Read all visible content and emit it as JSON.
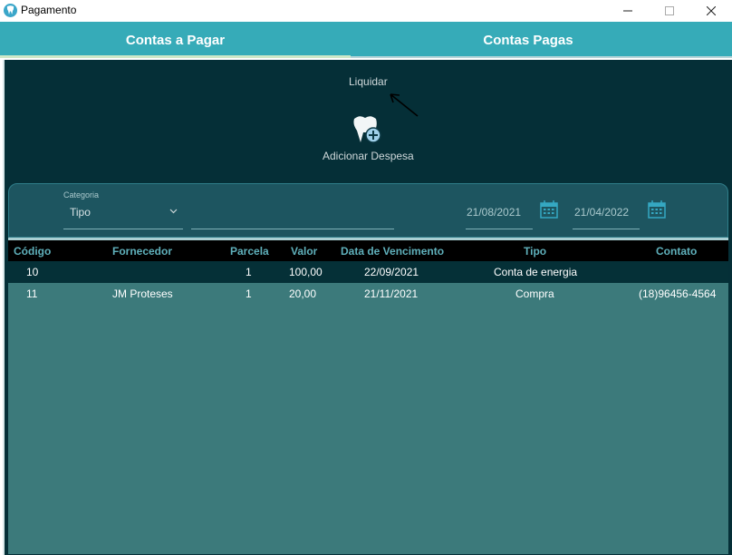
{
  "window": {
    "title": "Pagamento",
    "app_icon": "tooth-icon",
    "controls": [
      "minimize-icon",
      "maximize-icon",
      "close-icon"
    ]
  },
  "tabs": [
    {
      "label": "Contas a Pagar",
      "active": true
    },
    {
      "label": "Contas Pagas",
      "active": false
    }
  ],
  "actions": {
    "liquidar_label": "Liquidar",
    "add_expense_label": "Adicionar Despesa",
    "add_expense_icon": "tooth-add-icon"
  },
  "filters": {
    "category_label": "Categoria",
    "category_value": "Tipo",
    "search_value": "",
    "date_start": "21/08/2021",
    "date_end": "21/04/2022",
    "calendar_icon": "calendar-icon"
  },
  "table": {
    "headers": [
      "Código",
      "Fornecedor",
      "Parcela",
      "Valor",
      "Data de Vencimento",
      "Tipo",
      "Contato"
    ],
    "rows": [
      {
        "codigo": "10",
        "fornecedor": "",
        "parcela": "1",
        "valor": "100,00",
        "vencimento": "22/09/2021",
        "tipo": "Conta de energia",
        "contato": ""
      },
      {
        "codigo": "11",
        "fornecedor": "JM Proteses",
        "parcela": "1",
        "valor": "20,00",
        "vencimento": "21/11/2021",
        "tipo": "Compra",
        "contato": "(18)96456-4564"
      }
    ]
  },
  "colors": {
    "tab_bar": "#36abb8",
    "content_bg": "#052f37",
    "filter_panel": "#1d5560",
    "table_bg": "#3c7a7b",
    "header_bg": "#000000",
    "header_text": "#5fb0bb"
  }
}
